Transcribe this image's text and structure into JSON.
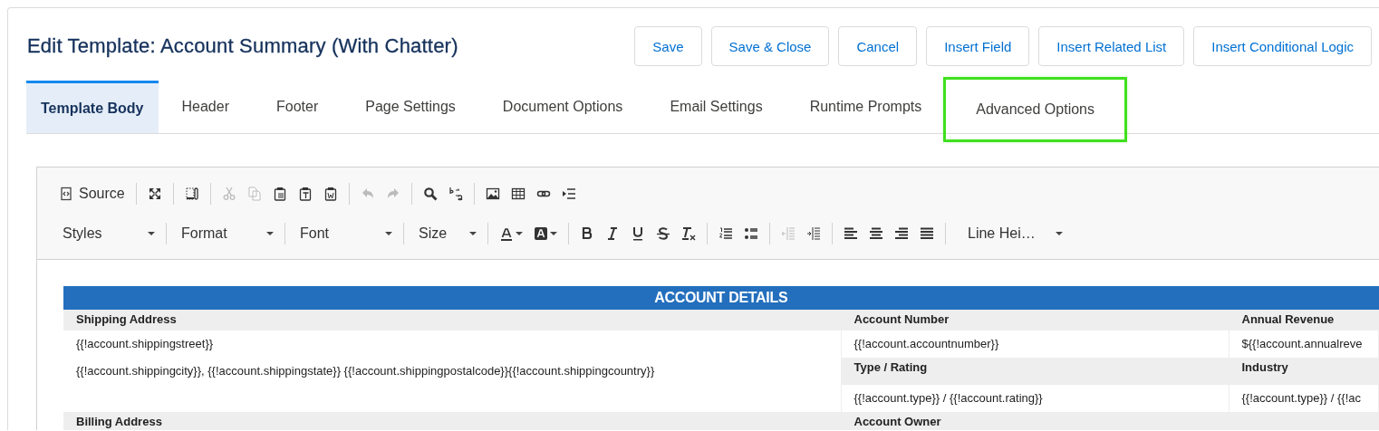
{
  "title": "Edit Template: Account Summary (With Chatter)",
  "buttons": [
    "Save",
    "Save & Close",
    "Cancel",
    "Insert Field",
    "Insert Related List",
    "Insert Conditional Logic"
  ],
  "tabs": [
    {
      "label": "Template Body",
      "selected": true,
      "highlighted": false
    },
    {
      "label": "Header",
      "selected": false,
      "highlighted": false
    },
    {
      "label": "Footer",
      "selected": false,
      "highlighted": false
    },
    {
      "label": "Page Settings",
      "selected": false,
      "highlighted": false
    },
    {
      "label": "Document Options",
      "selected": false,
      "highlighted": false
    },
    {
      "label": "Email Settings",
      "selected": false,
      "highlighted": false
    },
    {
      "label": "Runtime Prompts",
      "selected": false,
      "highlighted": false
    },
    {
      "label": "Advanced Options",
      "selected": false,
      "highlighted": true
    }
  ],
  "toolbar_rows": [
    [
      [
        {
          "kind": "source",
          "label": "Source",
          "disabled": false
        }
      ],
      [
        {
          "kind": "maximize",
          "disabled": false
        }
      ],
      [
        {
          "kind": "blocks",
          "disabled": false
        }
      ],
      [
        {
          "kind": "cut",
          "disabled": true
        },
        {
          "kind": "copy",
          "disabled": true
        },
        {
          "kind": "paste",
          "disabled": false
        },
        {
          "kind": "paste-text",
          "disabled": false
        },
        {
          "kind": "paste-word",
          "disabled": false
        }
      ],
      [
        {
          "kind": "undo",
          "disabled": true
        },
        {
          "kind": "redo",
          "disabled": true
        }
      ],
      [
        {
          "kind": "find",
          "disabled": false
        },
        {
          "kind": "replace",
          "disabled": false
        }
      ],
      [
        {
          "kind": "image",
          "disabled": false
        },
        {
          "kind": "table",
          "disabled": false
        },
        {
          "kind": "link",
          "disabled": false
        },
        {
          "kind": "pagebreak",
          "disabled": false
        }
      ]
    ],
    [
      [
        {
          "kind": "dropdown",
          "label": "Styles",
          "disabled": false
        }
      ],
      [
        {
          "kind": "dropdown",
          "label": "Format",
          "disabled": false
        }
      ],
      [
        {
          "kind": "dropdown",
          "label": "Font",
          "disabled": false
        }
      ],
      [
        {
          "kind": "dropdown",
          "label": "Size",
          "disabled": false
        }
      ],
      [
        {
          "kind": "text-color",
          "disabled": false
        },
        {
          "kind": "bg-color",
          "disabled": false
        }
      ],
      [
        {
          "kind": "bold",
          "disabled": false
        },
        {
          "kind": "italic",
          "disabled": false
        },
        {
          "kind": "underline",
          "disabled": false
        },
        {
          "kind": "strike",
          "disabled": false
        },
        {
          "kind": "clear-format",
          "disabled": false
        }
      ],
      [
        {
          "kind": "ol",
          "disabled": false
        },
        {
          "kind": "ul",
          "disabled": false
        }
      ],
      [
        {
          "kind": "outdent",
          "disabled": true
        },
        {
          "kind": "indent",
          "disabled": false
        }
      ],
      [
        {
          "kind": "align-left",
          "disabled": false
        },
        {
          "kind": "align-center",
          "disabled": false
        },
        {
          "kind": "align-right",
          "disabled": false
        },
        {
          "kind": "justify",
          "disabled": false
        }
      ],
      [
        {
          "kind": "dropdown",
          "label": "Line Hei…",
          "disabled": false
        }
      ]
    ]
  ],
  "table": {
    "title": "ACCOUNT DETAILS",
    "rows": [
      [
        {
          "kind": "head",
          "text": "Shipping Address"
        },
        {
          "kind": "head",
          "text": "Account Number"
        },
        {
          "kind": "head",
          "text": "Annual Revenue"
        }
      ],
      [
        {
          "kind": "value",
          "lines": [
            "{{!account.shippingstreet}}"
          ]
        },
        {
          "kind": "value",
          "lines": [
            "{{!account.accountnumber}}"
          ]
        },
        {
          "kind": "value",
          "lines": [
            "${{!account.annualreve"
          ]
        }
      ],
      [
        {
          "kind": "value",
          "lines": [
            "{{!account.shippingcity}}, {{!account.shippingstate}} {{!account.shippingpostalcode}}{{!account.shippingcountry}}"
          ]
        },
        {
          "kind": "head",
          "text": "Type / Rating"
        },
        {
          "kind": "head",
          "text": "Industry"
        }
      ],
      [
        {
          "kind": "blank"
        },
        {
          "kind": "value",
          "lines": [
            "{{!account.type}} / {{!account.rating}}"
          ]
        },
        {
          "kind": "value",
          "lines": [
            "{{!account.type}} / {{!ac"
          ]
        }
      ],
      [
        {
          "kind": "head",
          "text": "Billing Address"
        },
        {
          "kind": "head",
          "text": "Account Owner"
        },
        {
          "kind": "head",
          "text": ""
        }
      ]
    ]
  }
}
